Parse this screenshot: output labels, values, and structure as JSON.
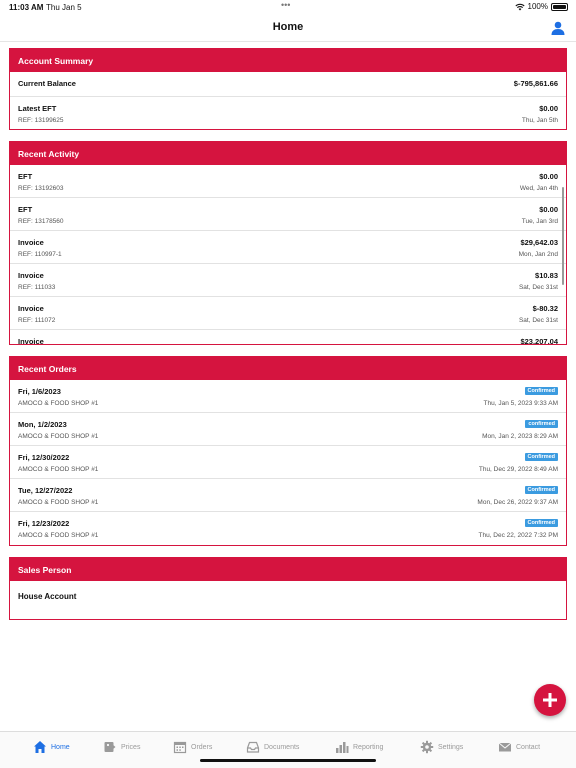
{
  "status_bar": {
    "time": "11:03 AM",
    "date": "Thu Jan 5",
    "dots": "•••",
    "battery": "100%"
  },
  "nav": {
    "title": "Home"
  },
  "account_summary": {
    "header": "Account Summary",
    "current_balance_label": "Current Balance",
    "current_balance_value": "$-795,861.66",
    "latest_eft_label": "Latest EFT",
    "latest_eft_value": "$0.00",
    "latest_eft_ref": "REF: 13199625",
    "latest_eft_date": "Thu, Jan 5th"
  },
  "recent_activity": {
    "header": "Recent Activity",
    "items": [
      {
        "type": "EFT",
        "ref": "REF: 13192603",
        "amount": "$0.00",
        "date": "Wed, Jan 4th"
      },
      {
        "type": "EFT",
        "ref": "REF: 13178560",
        "amount": "$0.00",
        "date": "Tue, Jan 3rd"
      },
      {
        "type": "Invoice",
        "ref": "REF: 110997-1",
        "amount": "$29,642.03",
        "date": "Mon, Jan 2nd"
      },
      {
        "type": "Invoice",
        "ref": "REF: 111033",
        "amount": "$10.83",
        "date": "Sat, Dec 31st"
      },
      {
        "type": "Invoice",
        "ref": "REF: 111072",
        "amount": "$-80.32",
        "date": "Sat, Dec 31st"
      },
      {
        "type": "Invoice",
        "ref": "",
        "amount": "$23,207.04",
        "date": ""
      }
    ]
  },
  "recent_orders": {
    "header": "Recent Orders",
    "items": [
      {
        "date": "Fri, 1/6/2023",
        "store": "AMOCO & FOOD SHOP #1",
        "status": "Confirmed",
        "timestamp": "Thu, Jan 5, 2023 9:33 AM"
      },
      {
        "date": "Mon, 1/2/2023",
        "store": "AMOCO & FOOD SHOP #1",
        "status": "confirmed",
        "timestamp": "Mon, Jan 2, 2023 8:29 AM"
      },
      {
        "date": "Fri, 12/30/2022",
        "store": "AMOCO & FOOD SHOP #1",
        "status": "Confirmed",
        "timestamp": "Thu, Dec 29, 2022 8:49 AM"
      },
      {
        "date": "Tue, 12/27/2022",
        "store": "AMOCO & FOOD SHOP #1",
        "status": "Confirmed",
        "timestamp": "Mon, Dec 26, 2022 9:37 AM"
      },
      {
        "date": "Fri, 12/23/2022",
        "store": "AMOCO & FOOD SHOP #1",
        "status": "Confirmed",
        "timestamp": "Thu, Dec 22, 2022 7:32 PM"
      }
    ]
  },
  "sales_person": {
    "header": "Sales Person",
    "name": "House Account"
  },
  "tabs": [
    {
      "label": "Home",
      "icon": "home-icon",
      "active": true
    },
    {
      "label": "Prices",
      "icon": "price-tag-icon",
      "active": false
    },
    {
      "label": "Orders",
      "icon": "calendar-icon",
      "active": false
    },
    {
      "label": "Documents",
      "icon": "inbox-icon",
      "active": false
    },
    {
      "label": "Reporting",
      "icon": "bar-chart-icon",
      "active": false
    },
    {
      "label": "Settings",
      "icon": "gear-icon",
      "active": false
    },
    {
      "label": "Contact",
      "icon": "envelope-icon",
      "active": false
    }
  ],
  "colors": {
    "brand": "#d5143f",
    "active_tab": "#1e6fe3",
    "badge": "#3b9be0"
  }
}
